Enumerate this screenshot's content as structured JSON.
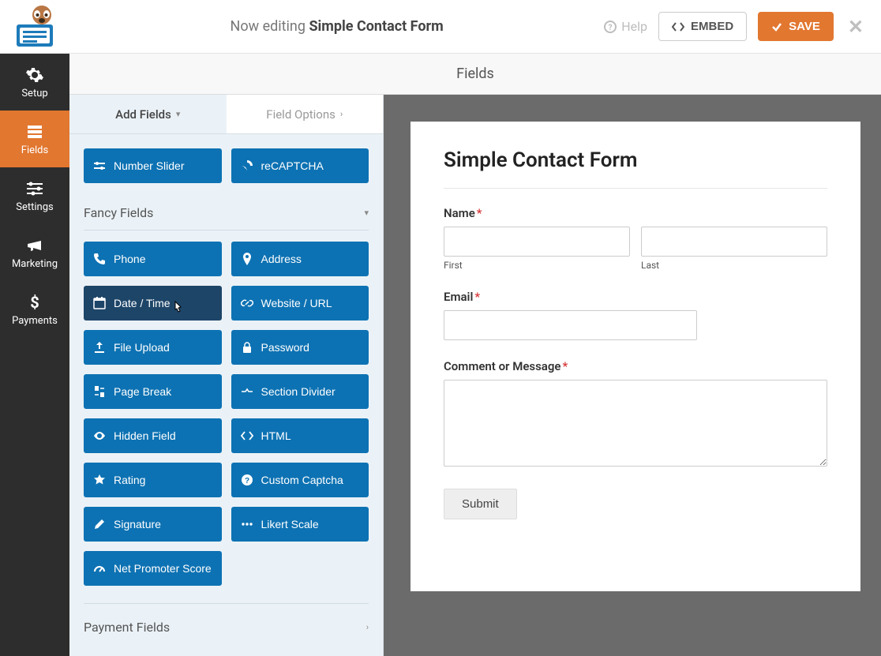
{
  "header": {
    "editing_prefix": "Now editing",
    "form_name": "Simple Contact Form",
    "help": "Help",
    "embed": "EMBED",
    "save": "SAVE"
  },
  "nav": {
    "setup": "Setup",
    "fields": "Fields",
    "settings": "Settings",
    "marketing": "Marketing",
    "payments": "Payments"
  },
  "panel_title": "Fields",
  "sidebar_tabs": {
    "add": "Add Fields",
    "options": "Field Options"
  },
  "top_fields": {
    "number_slider": "Number Slider",
    "recaptcha": "reCAPTCHA"
  },
  "sections": {
    "fancy": "Fancy Fields",
    "payment": "Payment Fields"
  },
  "fancy": {
    "phone": "Phone",
    "address": "Address",
    "datetime": "Date / Time",
    "website": "Website / URL",
    "fileupload": "File Upload",
    "password": "Password",
    "pagebreak": "Page Break",
    "sectiondivider": "Section Divider",
    "hiddenfield": "Hidden Field",
    "html": "HTML",
    "rating": "Rating",
    "customcaptcha": "Custom Captcha",
    "signature": "Signature",
    "likert": "Likert Scale",
    "nps": "Net Promoter Score"
  },
  "form": {
    "title": "Simple Contact Form",
    "name_label": "Name",
    "first_sub": "First",
    "last_sub": "Last",
    "email_label": "Email",
    "comment_label": "Comment or Message",
    "submit": "Submit"
  }
}
